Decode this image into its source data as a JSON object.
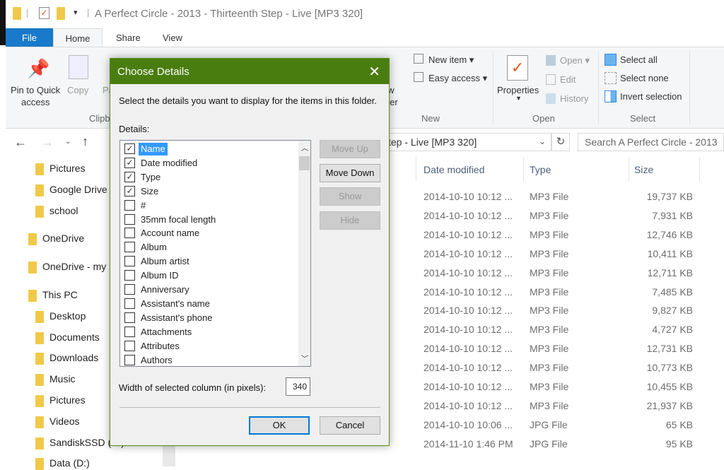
{
  "window": {
    "title": "A Perfect Circle - 2013 - Thirteenth Step - Live [MP3 320]"
  },
  "tabs": [
    {
      "label": "File"
    },
    {
      "label": "Home"
    },
    {
      "label": "Share"
    },
    {
      "label": "View"
    }
  ],
  "ribbon": {
    "clipboard": {
      "pin": "Pin to Quick",
      "pin2": "access",
      "copy": "Copy",
      "paste": "Pa",
      "group": "Clipb"
    },
    "new": {
      "new_folder1": "ew",
      "new_folder2": "lder",
      "new_item": "New item ▾",
      "easy_access": "Easy access ▾",
      "group": "New"
    },
    "open": {
      "properties": "Properties",
      "open": "Open ▾",
      "edit": "Edit",
      "history": "History",
      "group": "Open"
    },
    "select": {
      "select_all": "Select all",
      "select_none": "Select none",
      "invert": "Invert selection",
      "group": "Select"
    }
  },
  "address": {
    "path": "tep - Live [MP3 320]",
    "search_placeholder": "Search A Perfect Circle - 2013"
  },
  "nav": [
    {
      "label": "Pictures",
      "icon": "pictures-folder-icon"
    },
    {
      "label": "Google Drive",
      "icon": "google-drive-icon"
    },
    {
      "label": "school",
      "icon": "folder-icon"
    },
    {
      "label": "OneDrive",
      "icon": "onedrive-icon"
    },
    {
      "label": "OneDrive - my",
      "icon": "onedrive-folder-icon"
    },
    {
      "label": "This PC",
      "icon": "this-pc-icon"
    },
    {
      "label": "Desktop",
      "icon": "desktop-icon"
    },
    {
      "label": "Documents",
      "icon": "documents-icon"
    },
    {
      "label": "Downloads",
      "icon": "downloads-icon"
    },
    {
      "label": "Music",
      "icon": "music-icon"
    },
    {
      "label": "Pictures",
      "icon": "pictures-folder-icon"
    },
    {
      "label": "Videos",
      "icon": "videos-icon"
    },
    {
      "label": "SandiskSSD (C:)",
      "icon": "drive-icon"
    },
    {
      "label": "Data (D:)",
      "icon": "drive-icon"
    }
  ],
  "files": {
    "columns": [
      "Date modified",
      "Type",
      "Size"
    ],
    "rows": [
      [
        "2014-10-10 10:12 ...",
        "MP3 File",
        "19,737 KB"
      ],
      [
        "2014-10-10 10:12 ...",
        "MP3 File",
        "7,931 KB"
      ],
      [
        "2014-10-10 10:12 ...",
        "MP3 File",
        "12,746 KB"
      ],
      [
        "2014-10-10 10:12 ...",
        "MP3 File",
        "10,411 KB"
      ],
      [
        "2014-10-10 10:12 ...",
        "MP3 File",
        "12,711 KB"
      ],
      [
        "2014-10-10 10:12 ...",
        "MP3 File",
        "7,485 KB"
      ],
      [
        "2014-10-10 10:12 ...",
        "MP3 File",
        "9,827 KB"
      ],
      [
        "2014-10-10 10:12 ...",
        "MP3 File",
        "4,727 KB"
      ],
      [
        "2014-10-10 10:12 ...",
        "MP3 File",
        "12,731 KB"
      ],
      [
        "2014-10-10 10:12 ...",
        "MP3 File",
        "10,773 KB"
      ],
      [
        "2014-10-10 10:12 ...",
        "MP3 File",
        "10,455 KB"
      ],
      [
        "2014-10-10 10:12 ...",
        "MP3 File",
        "21,937 KB"
      ],
      [
        "2014-10-10 10:06 ...",
        "JPG File",
        "65 KB"
      ],
      [
        "2014-11-10 1:46 PM",
        "JPG File",
        "95 KB"
      ]
    ]
  },
  "dialog": {
    "title": "Choose Details",
    "instruction": "Select the details you want to display for the items in this folder.",
    "details_label": "Details:",
    "items": [
      {
        "label": "Name",
        "checked": true,
        "selected": true
      },
      {
        "label": "Date modified",
        "checked": true
      },
      {
        "label": "Type",
        "checked": true
      },
      {
        "label": "Size",
        "checked": true
      },
      {
        "label": "#",
        "checked": false
      },
      {
        "label": "35mm focal length",
        "checked": false
      },
      {
        "label": "Account name",
        "checked": false
      },
      {
        "label": "Album",
        "checked": false
      },
      {
        "label": "Album artist",
        "checked": false
      },
      {
        "label": "Album ID",
        "checked": false
      },
      {
        "label": "Anniversary",
        "checked": false
      },
      {
        "label": "Assistant's name",
        "checked": false
      },
      {
        "label": "Assistant's phone",
        "checked": false
      },
      {
        "label": "Attachments",
        "checked": false
      },
      {
        "label": "Attributes",
        "checked": false
      },
      {
        "label": "Authors",
        "checked": false
      }
    ],
    "buttons": {
      "move_up": "Move Up",
      "move_down": "Move Down",
      "show": "Show",
      "hide": "Hide",
      "ok": "OK",
      "cancel": "Cancel"
    },
    "width_label": "Width of selected column (in pixels):",
    "width_value": "340"
  },
  "colors": {
    "dialog_title": "#4a7d0f",
    "file_tab": "#1979ca",
    "selection": "#3399ff"
  }
}
